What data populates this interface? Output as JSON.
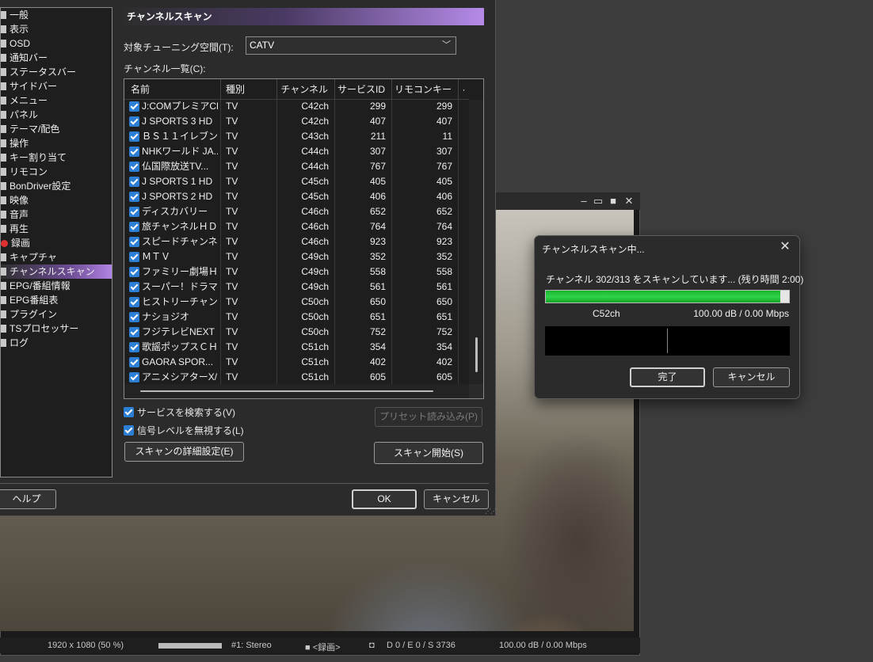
{
  "settings": {
    "categories": [
      {
        "label": "一般",
        "icon": "gear-icon"
      },
      {
        "label": "表示",
        "icon": "display-icon"
      },
      {
        "label": "OSD",
        "icon": "osd-icon"
      },
      {
        "label": "通知バー",
        "icon": "notification-icon"
      },
      {
        "label": "ステータスバー",
        "icon": "statusbar-icon"
      },
      {
        "label": "サイドバー",
        "icon": "sidebar-icon"
      },
      {
        "label": "メニュー",
        "icon": "menu-icon"
      },
      {
        "label": "パネル",
        "icon": "panel-icon"
      },
      {
        "label": "テーマ/配色",
        "icon": "theme-icon"
      },
      {
        "label": "操作",
        "icon": "operation-icon"
      },
      {
        "label": "キー割り当て",
        "icon": "key-icon"
      },
      {
        "label": "リモコン",
        "icon": "remote-icon"
      },
      {
        "label": "BonDriver設定",
        "icon": "bondriver-icon"
      },
      {
        "label": "映像",
        "icon": "video-icon"
      },
      {
        "label": "音声",
        "icon": "audio-icon"
      },
      {
        "label": "再生",
        "icon": "play-icon"
      },
      {
        "label": "録画",
        "icon": "record-icon"
      },
      {
        "label": "キャプチャ",
        "icon": "capture-icon"
      },
      {
        "label": "チャンネルスキャン",
        "icon": "scan-icon"
      },
      {
        "label": "EPG/番組情報",
        "icon": "epg-icon"
      },
      {
        "label": "EPG番組表",
        "icon": "program-guide-icon"
      },
      {
        "label": "プラグイン",
        "icon": "plugin-icon"
      },
      {
        "label": "TSプロセッサー",
        "icon": "ts-processor-icon"
      },
      {
        "label": "ログ",
        "icon": "log-icon"
      }
    ],
    "selected_category": "チャンネルスキャン",
    "panel_title": "チャンネルスキャン",
    "tuning_space_label": "対象チューニング空間(T):",
    "tuning_space_value": "CATV",
    "channel_list_label": "チャンネル一覧(C):",
    "columns": [
      "名前",
      "種別",
      "チャンネル",
      "サービスID",
      "リモコンキー"
    ],
    "channels": [
      {
        "name": "J:COMプレミアCH",
        "type": "TV",
        "channel": "C42ch",
        "service_id": "299",
        "remote_key": "299"
      },
      {
        "name": "J SPORTS 3 HD",
        "type": "TV",
        "channel": "C42ch",
        "service_id": "407",
        "remote_key": "407"
      },
      {
        "name": "ＢＳ１１イレブン",
        "type": "TV",
        "channel": "C43ch",
        "service_id": "211",
        "remote_key": "11"
      },
      {
        "name": "NHKワールド JA...",
        "type": "TV",
        "channel": "C44ch",
        "service_id": "307",
        "remote_key": "307"
      },
      {
        "name": "仏国際放送TV...",
        "type": "TV",
        "channel": "C44ch",
        "service_id": "767",
        "remote_key": "767"
      },
      {
        "name": "J SPORTS 1 HD",
        "type": "TV",
        "channel": "C45ch",
        "service_id": "405",
        "remote_key": "405"
      },
      {
        "name": "J SPORTS 2 HD",
        "type": "TV",
        "channel": "C45ch",
        "service_id": "406",
        "remote_key": "406"
      },
      {
        "name": "ディスカバリー",
        "type": "TV",
        "channel": "C46ch",
        "service_id": "652",
        "remote_key": "652"
      },
      {
        "name": "旅チャンネルＨＤ",
        "type": "TV",
        "channel": "C46ch",
        "service_id": "764",
        "remote_key": "764"
      },
      {
        "name": "スピードチャンネル",
        "type": "TV",
        "channel": "C46ch",
        "service_id": "923",
        "remote_key": "923"
      },
      {
        "name": "ＭＴＶ",
        "type": "TV",
        "channel": "C49ch",
        "service_id": "352",
        "remote_key": "352"
      },
      {
        "name": "ファミリー劇場ＨＤ",
        "type": "TV",
        "channel": "C49ch",
        "service_id": "558",
        "remote_key": "558"
      },
      {
        "name": "スーパー！ドラマ...",
        "type": "TV",
        "channel": "C49ch",
        "service_id": "561",
        "remote_key": "561"
      },
      {
        "name": "ヒストリーチャンネル",
        "type": "TV",
        "channel": "C50ch",
        "service_id": "650",
        "remote_key": "650"
      },
      {
        "name": "ナショジオ",
        "type": "TV",
        "channel": "C50ch",
        "service_id": "651",
        "remote_key": "651"
      },
      {
        "name": "フジテレビNEXT",
        "type": "TV",
        "channel": "C50ch",
        "service_id": "752",
        "remote_key": "752"
      },
      {
        "name": "歌謡ポップスＣＨ",
        "type": "TV",
        "channel": "C51ch",
        "service_id": "354",
        "remote_key": "354"
      },
      {
        "name": "GAORA SPOR...",
        "type": "TV",
        "channel": "C51ch",
        "service_id": "402",
        "remote_key": "402"
      },
      {
        "name": "アニメシアターX/...",
        "type": "TV",
        "channel": "C51ch",
        "service_id": "605",
        "remote_key": "605"
      }
    ],
    "search_services_label": "サービスを検索する(V)",
    "ignore_signal_label": "信号レベルを無視する(L)",
    "preset_load_label": "プリセット読み込み(P)",
    "scan_details_label": "スキャンの詳細設定(E)",
    "scan_start_label": "スキャン開始(S)",
    "help_label": "ヘルプ",
    "ok_label": "OK",
    "cancel_label": "キャンセル"
  },
  "scan_dialog": {
    "title": "チャンネルスキャン中...",
    "message": "チャンネル 302/313 をスキャンしています... (残り時間 2:00)",
    "progress_fraction": 0.965,
    "current_channel": "C52ch",
    "signal_info": "100.00 dB / 0.00 Mbps",
    "done_label": "完了",
    "cancel_label": "キャンセル"
  },
  "player": {
    "resolution": "1920 x 1080 (50 %)",
    "audio": "#1: Stereo",
    "recording": "■ <録画>",
    "drop_info": "D 0 / E 0 / S 3736",
    "signal": "100.00 dB / 0.00 Mbps",
    "volume_fraction": 1.0
  },
  "colors": {
    "accent_purple": "#b184e4",
    "checkbox_blue": "#2d7fd6",
    "progress_green": "#2fd44a"
  }
}
